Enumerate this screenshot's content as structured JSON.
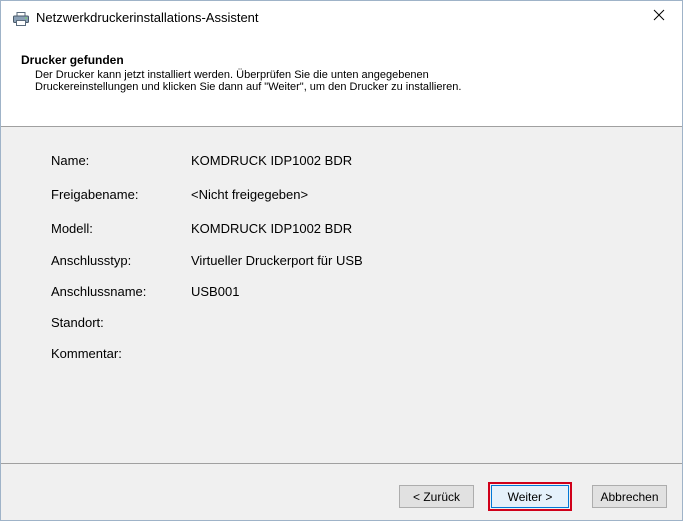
{
  "window": {
    "title": "Netzwerkdruckerinstallations-Assistent",
    "title_icon": "printer-icon",
    "close_icon": "close-icon"
  },
  "header": {
    "title": "Drucker gefunden",
    "desc_line1": "Der Drucker kann jetzt installiert werden. Überprüfen Sie die unten angegebenen",
    "desc_line2": "Druckereinstellungen und klicken Sie dann auf \"Weiter\", um den Drucker zu installieren."
  },
  "details": {
    "fields": [
      {
        "label": "Name:",
        "value": "KOMDRUCK IDP1002 BDR"
      },
      {
        "label": "Freigabename:",
        "value": "<Nicht freigegeben>"
      },
      {
        "label": "Modell:",
        "value": "KOMDRUCK IDP1002 BDR"
      },
      {
        "label": "Anschlusstyp:",
        "value": "Virtueller Druckerport für USB"
      },
      {
        "label": "Anschlussname:",
        "value": "USB001"
      },
      {
        "label": "Standort:",
        "value": ""
      },
      {
        "label": "Kommentar:",
        "value": ""
      }
    ]
  },
  "footer": {
    "back_label": "< Zurück",
    "next_label": "Weiter >",
    "cancel_label": "Abbrechen"
  },
  "colors": {
    "highlight": "#d0001a",
    "panel_bg": "#f0f0f0"
  }
}
